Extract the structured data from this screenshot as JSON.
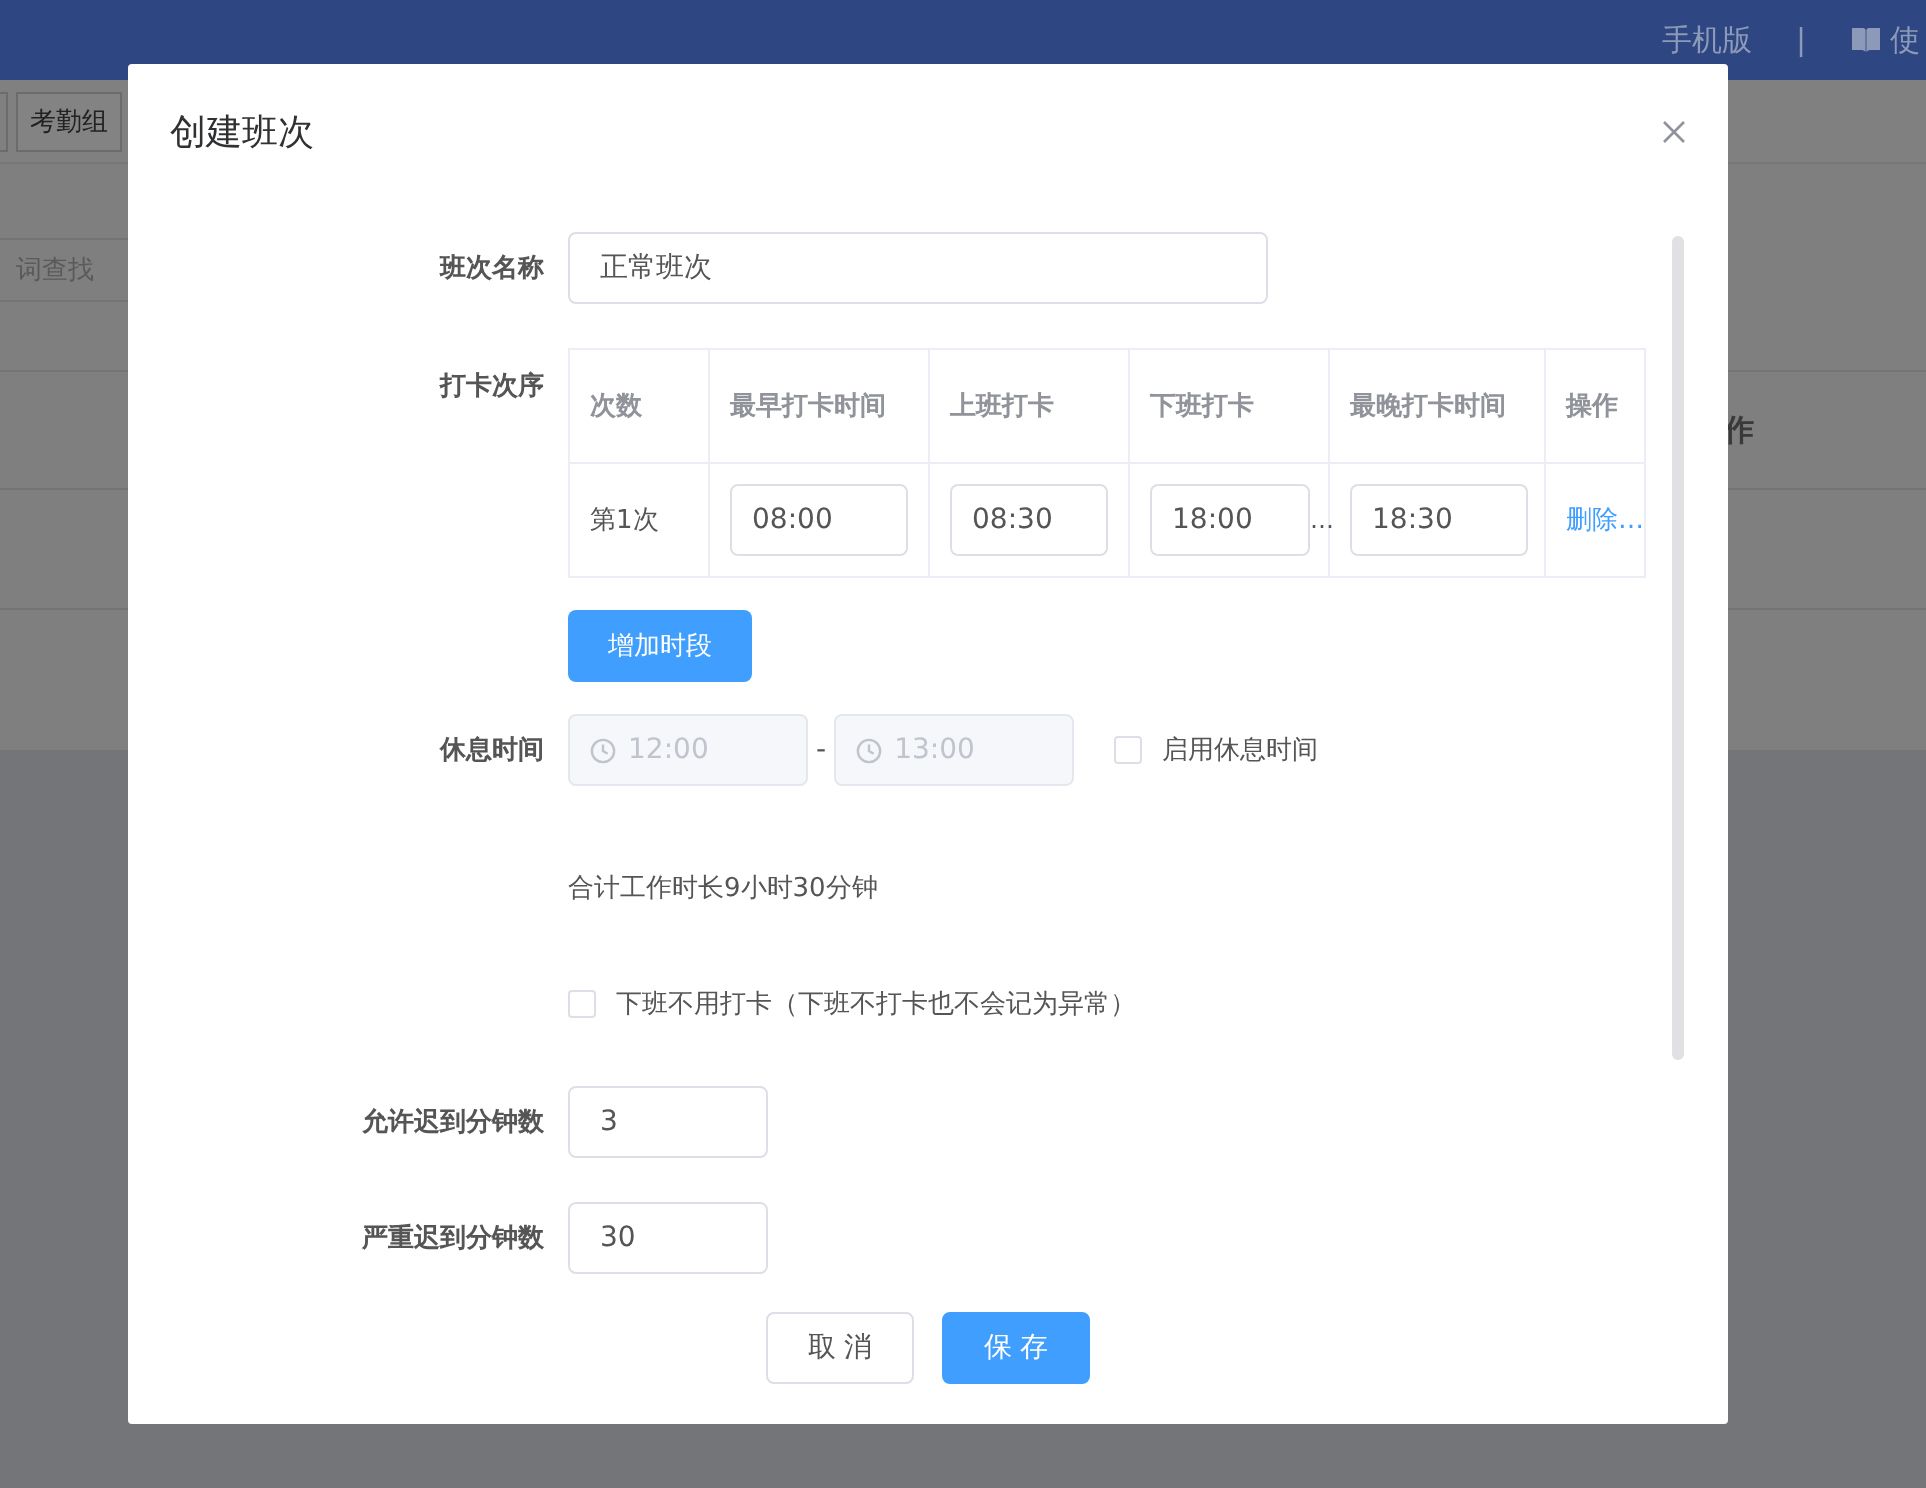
{
  "background": {
    "top_bar": {
      "links": [
        "手机版",
        "|",
        "使"
      ]
    },
    "toolbar": {
      "buttons": [
        "考勤组"
      ]
    },
    "search": {
      "placeholder": "词查找"
    },
    "table": {
      "columns": [
        "作"
      ]
    }
  },
  "dialog": {
    "title": "创建班次",
    "shift_name": {
      "label": "班次名称",
      "value": "正常班次"
    },
    "punch_order": {
      "label": "打卡次序",
      "columns": [
        "次数",
        "最早打卡时间",
        "上班打卡",
        "下班打卡",
        "最晚打卡时间",
        "操作"
      ],
      "rows": [
        {
          "index": "第1次",
          "earliest": "08:00",
          "on_duty": "08:30",
          "off_duty": "18:00",
          "off_duty_suffix": "…",
          "latest": "18:30",
          "action": "删除…"
        }
      ],
      "add_button": "增加时段"
    },
    "break_time": {
      "label": "休息时间",
      "start": "12:00",
      "separator": "-",
      "end": "13:00",
      "disabled": true,
      "enable": {
        "label": "启用休息时间",
        "checked": false
      }
    },
    "total": "合计工作时长9小时30分钟",
    "no_offduty_punch": {
      "label": "下班不用打卡（下班不打卡也不会记为异常）",
      "checked": false
    },
    "late_fields": [
      {
        "label": "允许迟到分钟数",
        "value": "3"
      },
      {
        "label": "严重迟到分钟数",
        "value": "30"
      }
    ],
    "buttons": [
      {
        "label": "取 消",
        "kind": "default"
      },
      {
        "label": "保 存",
        "kind": "primary"
      }
    ]
  }
}
